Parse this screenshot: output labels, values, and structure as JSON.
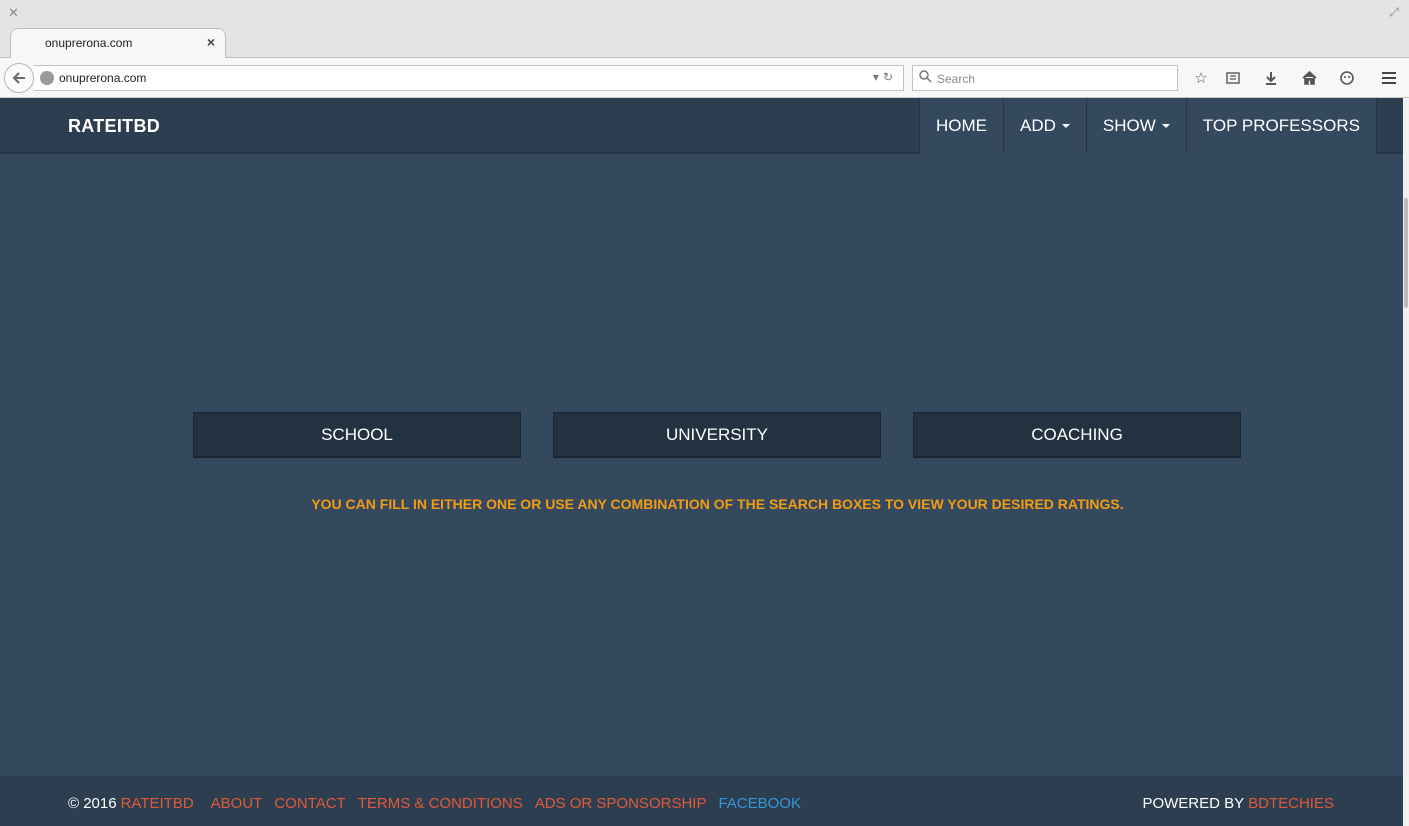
{
  "browser": {
    "tab_title": "onuprerona.com",
    "url": "onuprerona.com",
    "search_placeholder": "Search"
  },
  "site": {
    "brand": "RATEITBD",
    "nav": [
      {
        "label": "HOME",
        "has_dropdown": false
      },
      {
        "label": "ADD",
        "has_dropdown": true
      },
      {
        "label": "SHOW",
        "has_dropdown": true
      },
      {
        "label": "TOP PROFESSORS",
        "has_dropdown": false
      }
    ],
    "categories": [
      "SCHOOL",
      "UNIVERSITY",
      "COACHING"
    ],
    "info": "YOU CAN FILL IN EITHER ONE OR USE ANY COMBINATION OF THE SEARCH BOXES TO VIEW YOUR DESIRED RATINGS."
  },
  "footer": {
    "copyright": "© 2016",
    "links": [
      "RATEITBD",
      "ABOUT",
      "CONTACT",
      "TERMS & CONDITIONS",
      "ADS OR SPONSORSHIP"
    ],
    "facebook": "FACEBOOK",
    "powered_by": "POWERED BY",
    "powered_link": "BDTECHIES"
  },
  "colors": {
    "page_bg": "#34495e",
    "nav_bg": "#2c3e50",
    "accent_orange": "#f39c12",
    "link_red": "#e05a3a",
    "link_blue": "#3498db"
  }
}
